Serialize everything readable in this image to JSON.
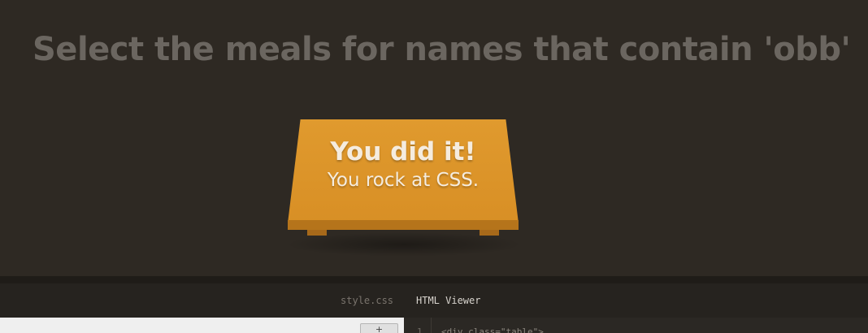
{
  "game": {
    "instruction": "Select the meals for names that contain 'obb'",
    "win_title": "You did it!",
    "win_subtitle": "You rock at CSS."
  },
  "editor": {
    "tabs": [
      {
        "label": "style.css",
        "active": false
      },
      {
        "label": "HTML Viewer",
        "active": true
      }
    ],
    "enter_button_label": "+",
    "line_numbers": [
      "1"
    ],
    "code_lines": [
      "<div class=\"table\">"
    ]
  },
  "colors": {
    "background": "#2e2923",
    "table": "#e09a2e",
    "instruction_text": "#6b6660"
  }
}
